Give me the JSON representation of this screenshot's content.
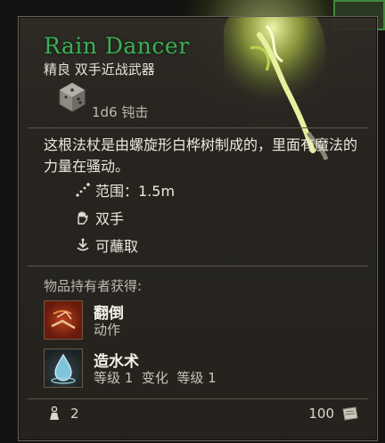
{
  "item": {
    "name": "Rain Dancer",
    "subtitle": "精良 双手近战武器",
    "damage": "1d6 钝击",
    "description": "这根法杖是由螺旋形白桦树制成的，里面有魔法的力量在骚动。",
    "properties": [
      {
        "icon": "range-icon",
        "label": "范围：1.5m"
      },
      {
        "icon": "two-hands-icon",
        "label": "双手"
      },
      {
        "icon": "dippable-icon",
        "label": "可蘸取"
      }
    ],
    "grants_label": "物品持有者获得:",
    "abilities": [
      {
        "icon": "topple-icon",
        "name": "翻倒",
        "sub": "动作"
      },
      {
        "icon": "create-water-icon",
        "name": "造水术",
        "sub": "等级 1  变化  等级 1"
      }
    ],
    "weight": "2",
    "value": "100"
  },
  "colors": {
    "rarity_uncommon": "#3cae59",
    "panel_bg": "#2e2a25",
    "text": "#ebe7dd"
  }
}
